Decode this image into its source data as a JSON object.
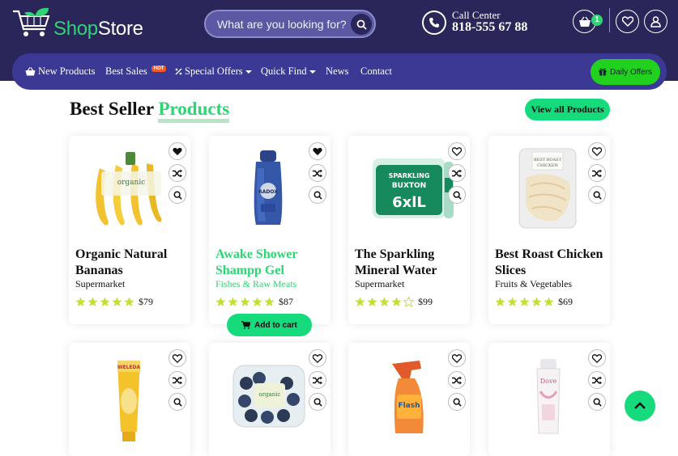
{
  "header": {
    "logo_left": "Shop",
    "logo_right": "Store",
    "search_placeholder": "What are you looking for?",
    "call_label": "Call Center",
    "call_number": "818-555 67 88",
    "cart_count": "1"
  },
  "nav": {
    "items": [
      {
        "label": "New Products",
        "icon": "basket-icon"
      },
      {
        "label": "Best Sales",
        "badge": "HOT"
      },
      {
        "label": "Special Offers",
        "icon": "percent-icon",
        "dropdown": true
      },
      {
        "label": "Quick Find",
        "dropdown": true
      },
      {
        "label": "News"
      },
      {
        "label": "Contact"
      }
    ],
    "daily_offers": "Daily Offers"
  },
  "section": {
    "title_main": "Best Seller",
    "title_accent": "Products",
    "view_all": "View all Products"
  },
  "products": [
    {
      "name": "Organic Natural Bananas",
      "category": "Supermarket",
      "price": "$79",
      "rating": 5,
      "wishlisted": true
    },
    {
      "name": "Awake Shower Shampp Gel",
      "category": "Fishes & Raw Meats",
      "price": "$87",
      "rating": 5,
      "wishlisted": true,
      "highlighted": true
    },
    {
      "name": "The Sparkling Mineral Water",
      "category": "Supermarket",
      "price": "$99",
      "rating": 4,
      "wishlisted": false
    },
    {
      "name": "Best Roast Chicken Slices",
      "category": "Fruits & Vegetables",
      "price": "$69",
      "rating": 5,
      "wishlisted": false
    },
    {
      "name": "",
      "category": "",
      "price": "",
      "wishlisted": false
    },
    {
      "name": "",
      "category": "",
      "price": "",
      "wishlisted": false
    },
    {
      "name": "",
      "category": "",
      "price": "",
      "wishlisted": false
    },
    {
      "name": "",
      "category": "",
      "price": "",
      "wishlisted": false
    }
  ],
  "add_to_cart": "Add to cart",
  "colors": {
    "header_bg": "#2a2659",
    "nav_bg": "#3b3994",
    "accent_green": "#2ed573",
    "button_green": "#15db7d",
    "star": "#c5de3a"
  }
}
